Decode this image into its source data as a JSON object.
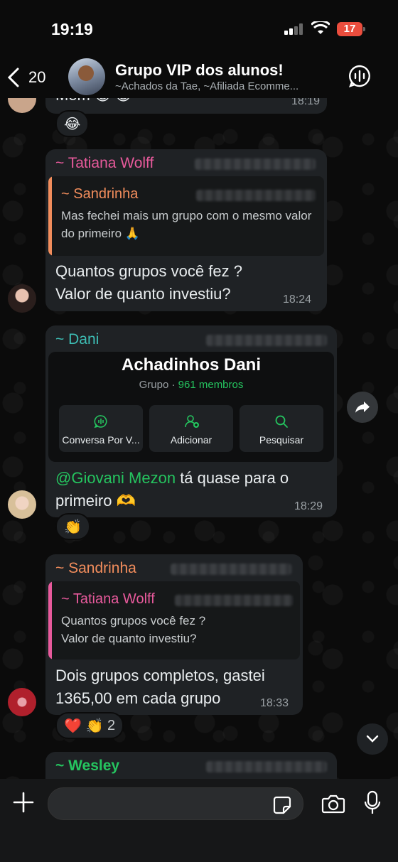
{
  "status_bar": {
    "time": "19:19",
    "battery": "17"
  },
  "header": {
    "back_count": "20",
    "title": "Grupo VIP dos alunos!",
    "subtitle": "~Achados da Tae, ~Afiliada Ecomme..."
  },
  "colors": {
    "tatiana": "#e85a9c",
    "sandrinha": "#f28d5c",
    "dani": "#3dbdb4",
    "mention": "#25c45f",
    "wesley": "#25c45f"
  },
  "messages": {
    "top": {
      "text": "Mom",
      "time": "18:19",
      "reaction": "😂"
    },
    "m1": {
      "sender": "~ Tatiana Wolff",
      "quote_sender": "~ Sandrinha",
      "quote_text": "Mas fechei mais um grupo com o mesmo valor do primeiro 🙏",
      "line1": "Quantos grupos você fez ?",
      "line2": "Valor de quanto investiu?",
      "time": "18:24"
    },
    "m2": {
      "sender": "~ Dani",
      "group_name": "Achadinhos Dani",
      "group_type": "Grupo · ",
      "group_members": "961 membros",
      "buttons": [
        "Conversa Por V...",
        "Adicionar",
        "Pesquisar"
      ],
      "mention": "@Giovani Mezon",
      "line1_rest": " tá quase para o",
      "line2": "primeiro 🫶",
      "time": "18:29",
      "reaction": "👏"
    },
    "m3": {
      "sender": "~ Sandrinha",
      "quote_sender": "~ Tatiana Wolff",
      "quote_line1": "Quantos grupos você fez ?",
      "quote_line2": "Valor de quanto investiu?",
      "line1": "Dois grupos completos, gastei",
      "line2": "1365,00 em cada grupo",
      "time": "18:33",
      "reactions": "❤️ 👏",
      "reaction_count": "2"
    },
    "m4": {
      "sender": "~ Wesley"
    }
  },
  "composer": {
    "placeholder": ""
  }
}
